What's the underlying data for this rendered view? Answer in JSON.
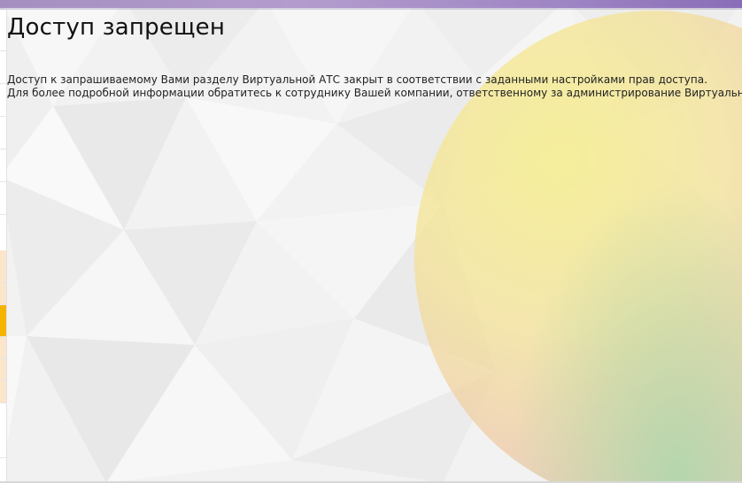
{
  "page": {
    "title": "Доступ запрещен",
    "message_line_1": "Доступ к запрашиваемому Вами разделу Виртуальной АТС закрыт в соответствии с заданными настройками прав доступа.",
    "message_line_2": "Для более подробной информации обратитесь к сотруднику Вашей компании, ответственному за администрирование Виртуальной АТС."
  },
  "colors": {
    "top_bar": "#a58fc0",
    "active_strip": "#f5b400",
    "strip_highlight": "#fbe6cb",
    "text": "#111111"
  },
  "decorations": {
    "background": "low-poly-pattern",
    "orb": "gradient-circle"
  }
}
